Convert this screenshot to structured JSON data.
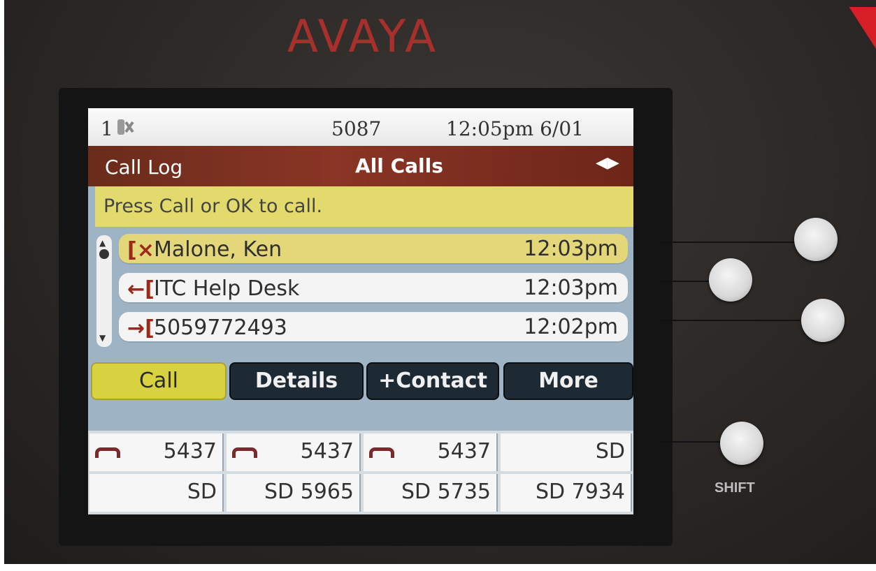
{
  "device": {
    "brand": "AVAYA",
    "shift_label": "SHIFT"
  },
  "status": {
    "line_number": "1",
    "extension": "5087",
    "clock": "12:05pm 6/01"
  },
  "header": {
    "app_title": "Call Log",
    "filter": "All Calls",
    "nav_icon": "left-right-arrows-icon"
  },
  "prompt": "Press Call or OK to call.",
  "call_log": [
    {
      "type": "missed",
      "icon": "[×",
      "name": "Malone, Ken",
      "time": "12:03pm",
      "selected": true
    },
    {
      "type": "incoming",
      "icon": "←[",
      "name": "ITC Help Desk",
      "time": "12:03pm",
      "selected": false
    },
    {
      "type": "outgoing",
      "icon": "→[",
      "name": "5059772493",
      "time": "12:02pm",
      "selected": false
    }
  ],
  "softkeys": [
    "Call",
    "Details",
    "+Contact",
    "More"
  ],
  "line_keys": [
    {
      "label": "5437",
      "handset": true
    },
    {
      "label": "5437",
      "handset": true
    },
    {
      "label": "5437",
      "handset": true
    },
    {
      "label": "SD",
      "handset": false
    },
    {
      "label": "SD",
      "handset": false
    },
    {
      "label": "SD 5965",
      "handset": false
    },
    {
      "label": "SD 5735",
      "handset": false
    },
    {
      "label": "SD 7934",
      "handset": false
    }
  ],
  "colors": {
    "brand": "#a8302c",
    "title_bar": "#8a3526",
    "prompt_bg": "#e2da6d",
    "selected_row": "#e4d77a",
    "softkey_active": "#d9d240",
    "softkey": "#1d2a33"
  }
}
